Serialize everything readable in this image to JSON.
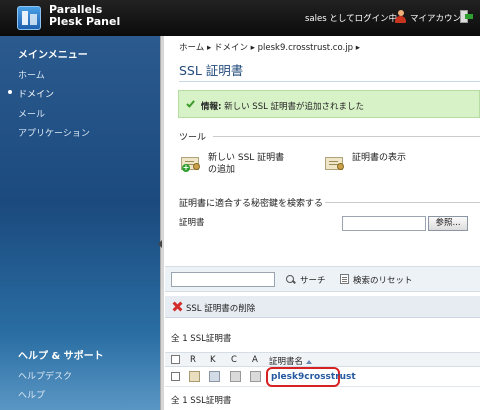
{
  "topbar": {
    "brand_line1": "Parallels",
    "brand_line2": "Plesk Panel",
    "login_status": "sales としてログイン中",
    "account_label": "マイアカウント"
  },
  "sidebar": {
    "main_menu_title": "メインメニュー",
    "items": [
      {
        "label": "ホーム"
      },
      {
        "label": "ドメイン"
      },
      {
        "label": "メール"
      },
      {
        "label": "アプリケーション"
      }
    ],
    "help_title": "ヘルプ & サポート",
    "help_items": [
      {
        "label": "ヘルプデスク"
      },
      {
        "label": "ヘルプ"
      }
    ]
  },
  "breadcrumb": {
    "home": "ホーム",
    "domains": "ドメイン",
    "domain": "plesk9.crosstrust.co.jp",
    "sep": "▸"
  },
  "page": {
    "title": "SSL 証明書",
    "info_label": "情報:",
    "info_message": "新しい SSL 証明書が追加されました"
  },
  "tools": {
    "section_label": "ツール",
    "add_line1": "新しい SSL 証明書",
    "add_line2": "の追加",
    "view": "証明書の表示"
  },
  "key_search": {
    "section_label": "証明書に適合する秘密鍵を検索する",
    "field_label": "証明書",
    "field_value": "",
    "browse_button": "参照..."
  },
  "filter": {
    "search_value": "",
    "search_button": "サーチ",
    "reset_button": "検索のリセット"
  },
  "actions": {
    "delete_label": "SSL 証明書の削除"
  },
  "table": {
    "count_top": "全 1 SSL証明書",
    "count_bottom": "全 1 SSL証明書",
    "columns": [
      "R",
      "K",
      "C",
      "A",
      "証明書名"
    ],
    "rows": [
      {
        "name": "plesk9crosstrust"
      }
    ]
  }
}
